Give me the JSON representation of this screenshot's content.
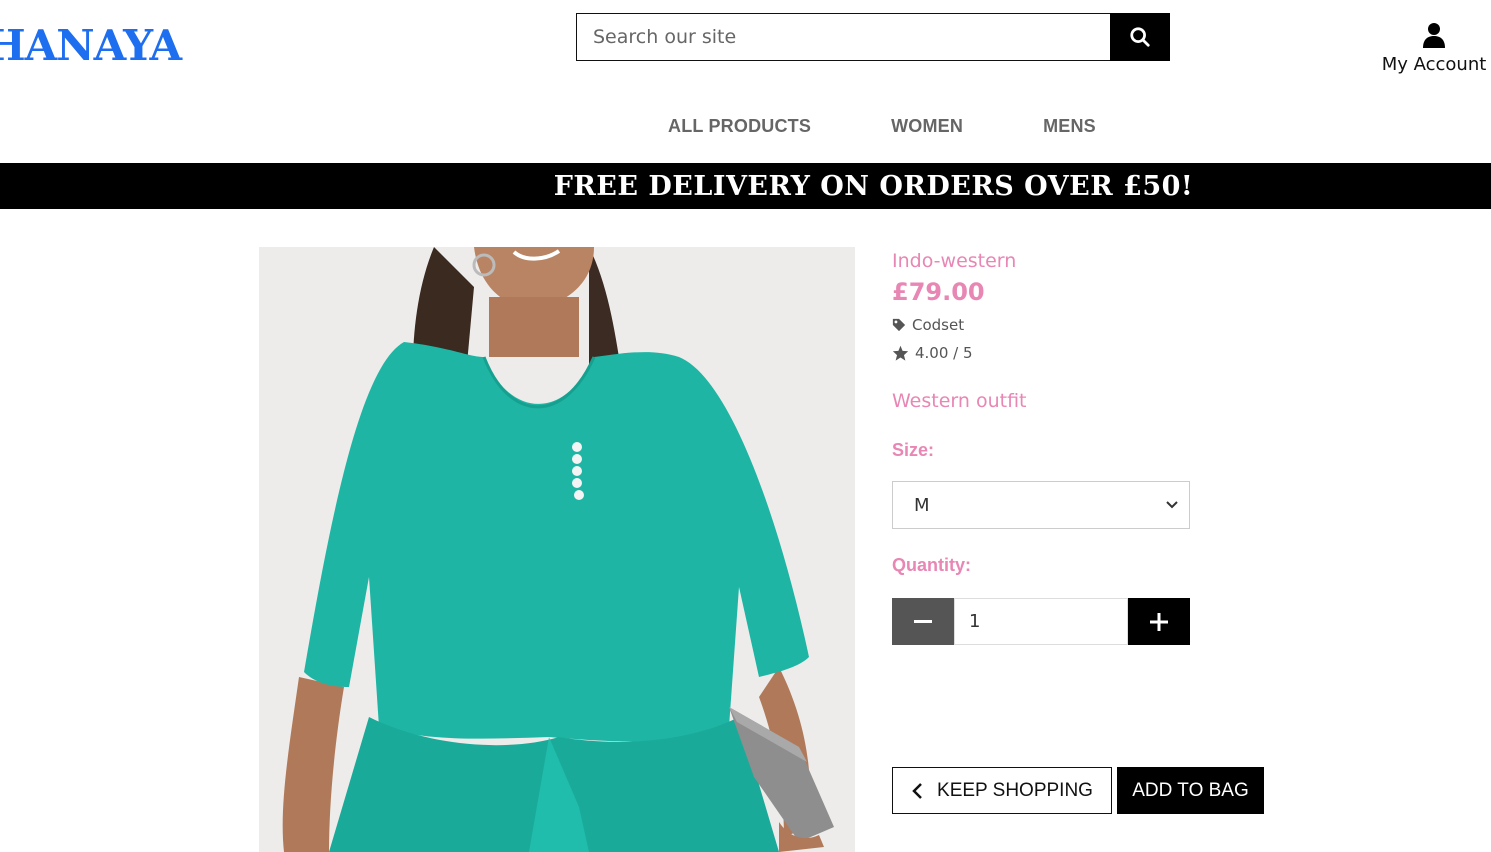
{
  "header": {
    "logo_text": "HANAYA",
    "search": {
      "placeholder": "Search our site",
      "value": ""
    },
    "account_label": "My Account"
  },
  "nav": {
    "items": [
      {
        "label": "ALL PRODUCTS"
      },
      {
        "label": "WOMEN"
      },
      {
        "label": "MENS"
      }
    ]
  },
  "banner": {
    "text": "FREE DELIVERY ON ORDERS OVER £50!"
  },
  "product": {
    "name": "Indo-western",
    "price": "£79.00",
    "category": "Codset",
    "rating": "4.00 / 5",
    "description": "Western outfit",
    "size_label": "Size:",
    "size_selected": "M",
    "quantity_label": "Quantity:",
    "quantity_value": "1",
    "keep_shopping_label": "KEEP SHOPPING",
    "add_to_bag_label": "ADD TO BAG"
  },
  "icons": {
    "search": "search-icon",
    "account": "user-icon",
    "tag": "tag-icon",
    "star": "star-icon",
    "chevron": "chevron-down-icon",
    "minus": "minus-icon",
    "plus": "plus-icon",
    "back": "chevron-left-icon"
  },
  "colors": {
    "logo": "#1e6ef0",
    "accent_pink": "#e886b4",
    "banner_bg": "#000000",
    "garment_teal": "#1fb5a5"
  }
}
